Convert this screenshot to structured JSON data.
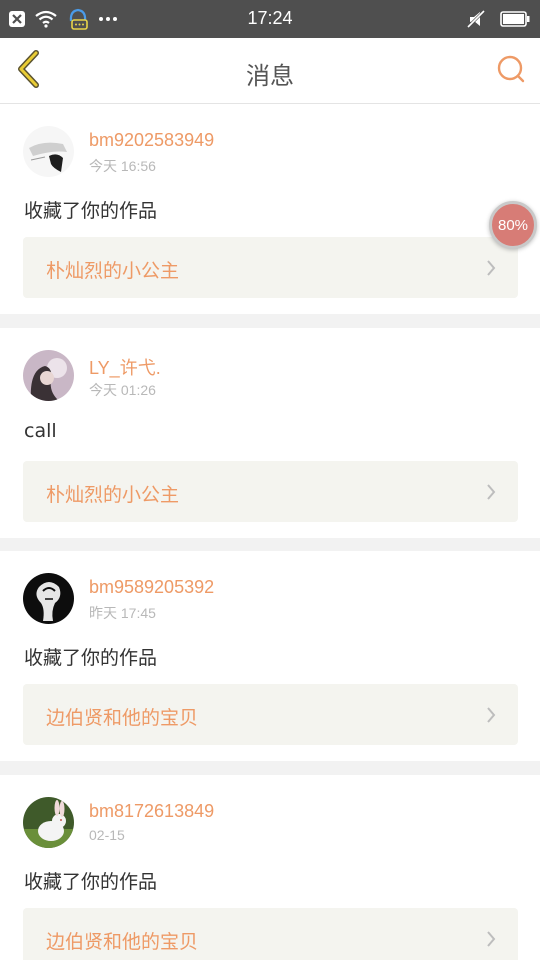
{
  "status_bar": {
    "time": "17:24",
    "left_icons": [
      "close-notification-icon",
      "wifi-icon",
      "chat-app-icon",
      "more-dots-icon"
    ],
    "right_icons": [
      "mute-icon",
      "battery-icon"
    ]
  },
  "header": {
    "title": "消息",
    "back_icon": "chevron-left-icon",
    "search_icon": "search-icon",
    "accent_color": "#ee9a66"
  },
  "messages": [
    {
      "user": "bm9202583949",
      "time": "今天 16:56",
      "text": "收藏了你的作品",
      "work": "朴灿烈的小公主"
    },
    {
      "user": "LY_许弋.",
      "time": "今天 01:26",
      "text": "call",
      "work": "朴灿烈的小公主"
    },
    {
      "user": "bm9589205392",
      "time": "昨天 17:45",
      "text": "收藏了你的作品",
      "work": "边伯贤和他的宝贝"
    },
    {
      "user": "bm8172613849",
      "time": "02-15",
      "text": "收藏了你的作品",
      "work": "边伯贤和他的宝贝"
    }
  ],
  "float_badge": {
    "label": "80%"
  }
}
